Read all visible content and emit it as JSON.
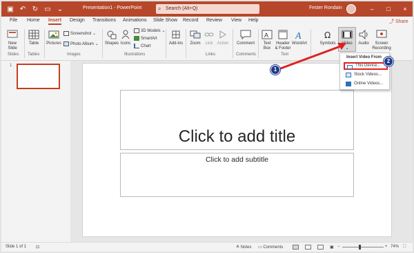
{
  "titlebar": {
    "title": "Presentation1 - PowerPoint",
    "search_placeholder": "Search (Alt+Q)",
    "user": "Fester Rondain",
    "minimize": "–",
    "restore": "□",
    "close": "×"
  },
  "tabs": [
    "File",
    "Home",
    "Insert",
    "Design",
    "Transitions",
    "Animations",
    "Slide Show",
    "Record",
    "Review",
    "View",
    "Help"
  ],
  "share_label": "Share",
  "ribbon": {
    "new_slide": "New Slide",
    "table": "Table",
    "pictures": "Pictures",
    "screenshot": "Screenshot",
    "photo_album": "Photo Album",
    "shapes": "Shapes",
    "icons": "Icons",
    "models_3d": "3D Models",
    "smartart": "SmartArt",
    "chart": "Chart",
    "addins": "Add-ins",
    "zoom": "Zoom",
    "link": "Link",
    "action": "Action",
    "comment": "Comment",
    "text_box": "Text Box",
    "header_footer": "Header & Footer",
    "wordart": "WordArt",
    "symbols": "Symbols",
    "video": "Video",
    "audio": "Audio",
    "screen_recording": "Screen Recording",
    "groups": {
      "slides": "Slides",
      "tables": "Tables",
      "images": "Images",
      "illustrations": "Illustrations",
      "links": "Links",
      "comments": "Comments",
      "text": "Text"
    }
  },
  "thumbnail": {
    "number": "1"
  },
  "slide": {
    "title_placeholder": "Click to add title",
    "subtitle_placeholder": "Click to add subtitle"
  },
  "dropdown": {
    "header": "Insert Video From",
    "items": [
      "This Device...",
      "Stock Videos...",
      "Online Videos..."
    ]
  },
  "badges": [
    "1",
    "2"
  ],
  "status": {
    "slide_info": "Slide 1 of 1",
    "notes": "Notes",
    "comments": "Comments",
    "zoom": "74%"
  },
  "colors": {
    "accent": "#b7472a",
    "annotation_red": "#e02020",
    "badge_blue": "#1f3a8a"
  }
}
